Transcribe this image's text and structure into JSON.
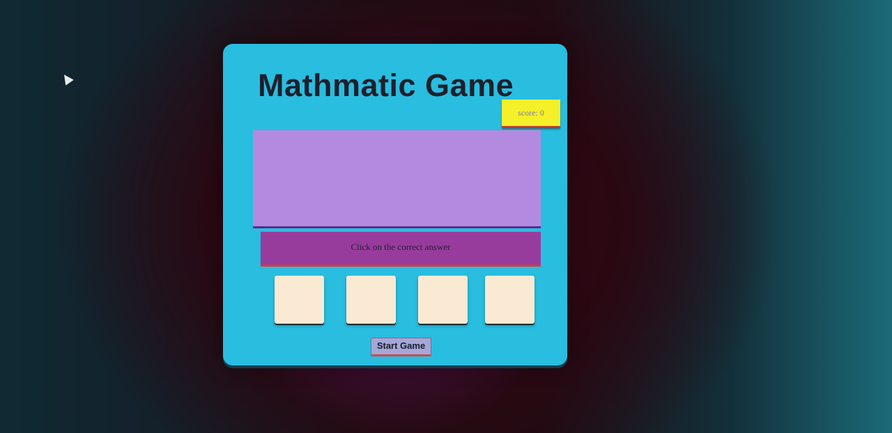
{
  "game": {
    "title": "Mathmatic Game",
    "score_label": "score: 0",
    "question": "",
    "instruction": "Click on the correct answer",
    "choices": [
      "",
      "",
      "",
      ""
    ],
    "start_label": "Start Game"
  },
  "colors": {
    "panel": "#29bde0",
    "score_box": "#f4f02a",
    "question_box": "#b28be0",
    "instruction_box": "#973c9d",
    "choice_box": "#fbead3",
    "start_button": "#a5a7d6"
  },
  "icons": {
    "cursor": "mouse-pointer-icon"
  }
}
